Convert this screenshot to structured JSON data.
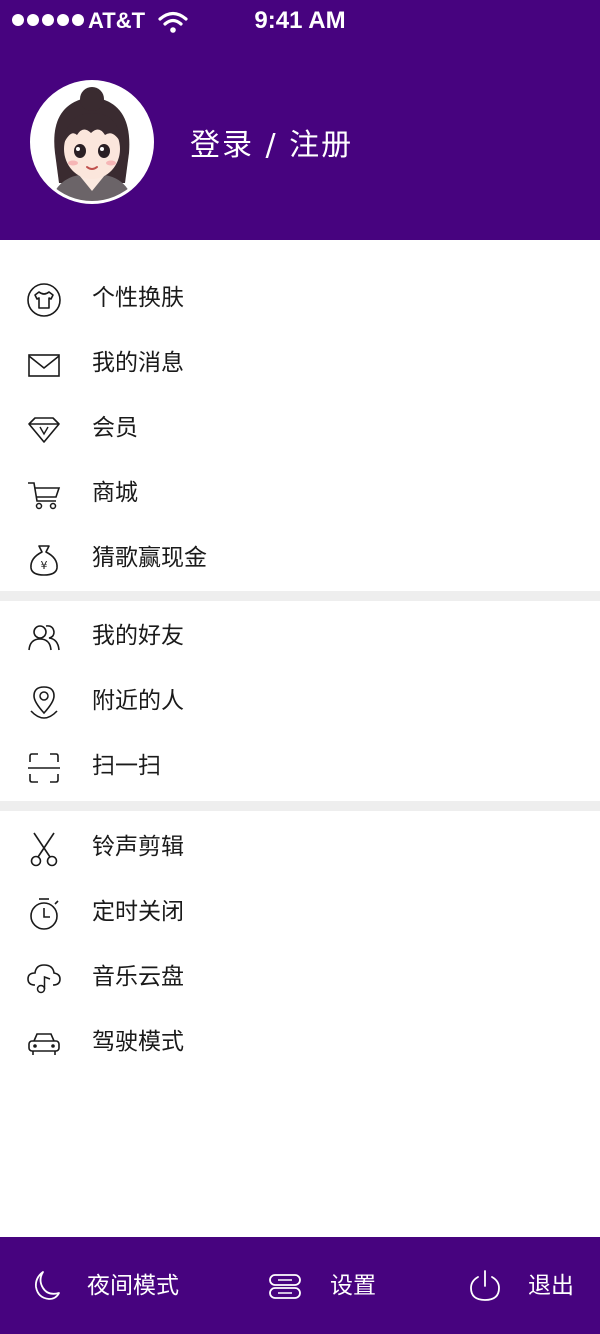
{
  "status_bar": {
    "carrier": "AT&T",
    "time": "9:41 AM"
  },
  "header": {
    "login_label": "登录 / 注册"
  },
  "menu_group_1": [
    {
      "label": "个性换肤",
      "icon": "tshirt-icon"
    },
    {
      "label": "我的消息",
      "icon": "envelope-icon"
    },
    {
      "label": "会员",
      "icon": "diamond-vip-icon"
    },
    {
      "label": "商城",
      "icon": "cart-icon"
    },
    {
      "label": "猜歌赢现金",
      "icon": "money-bag-icon"
    }
  ],
  "menu_group_2": [
    {
      "label": "我的好友",
      "icon": "friends-icon"
    },
    {
      "label": "附近的人",
      "icon": "location-pin-icon"
    },
    {
      "label": "扫一扫",
      "icon": "scan-icon"
    }
  ],
  "menu_group_3": [
    {
      "label": "铃声剪辑",
      "icon": "scissors-icon"
    },
    {
      "label": "定时关闭",
      "icon": "timer-icon"
    },
    {
      "label": "音乐云盘",
      "icon": "cloud-music-icon"
    },
    {
      "label": "驾驶模式",
      "icon": "car-icon"
    }
  ],
  "footer": {
    "night_mode_label": "夜间模式",
    "settings_label": "设置",
    "logout_label": "退出"
  },
  "colors": {
    "brand": "#47037f",
    "divider": "#eeeeee",
    "text": "#1a1a1a"
  }
}
